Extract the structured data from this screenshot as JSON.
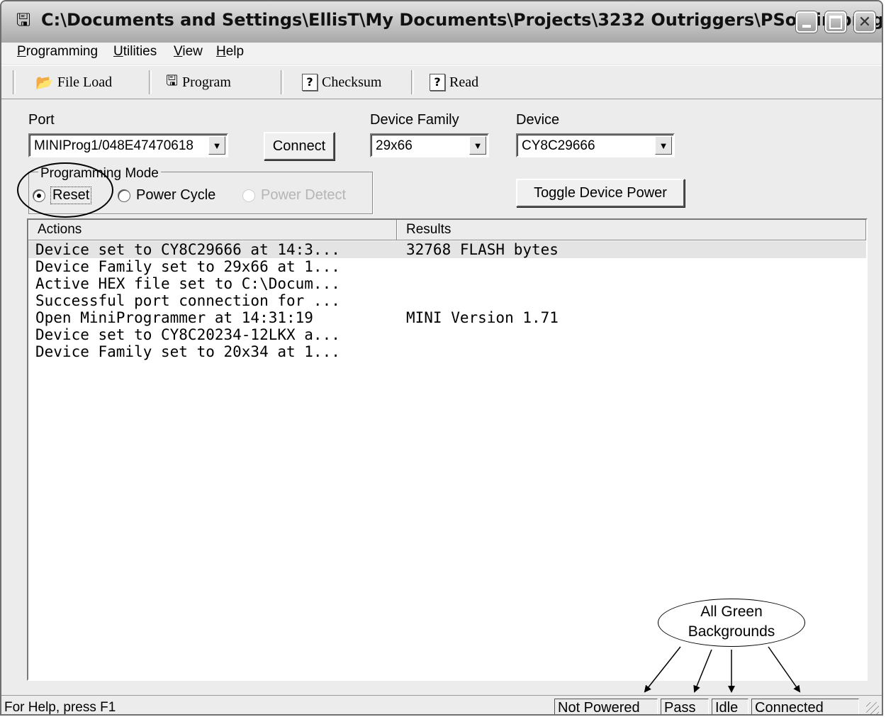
{
  "window": {
    "title": "C:\\Documents and Settings\\EllisT\\My Documents\\Projects\\3232 Outriggers\\PSoC\\in progress...",
    "icon": "programmer-app-icon",
    "controls": [
      "minimize",
      "maximize",
      "close"
    ]
  },
  "menu": [
    {
      "mnemonic": "P",
      "rest": "rogramming"
    },
    {
      "mnemonic": "U",
      "rest": "tilities"
    },
    {
      "mnemonic": "V",
      "rest": "iew"
    },
    {
      "mnemonic": "H",
      "rest": "elp"
    }
  ],
  "toolbar": {
    "file_load": "File Load",
    "program": "Program",
    "checksum": "Checksum",
    "read": "Read",
    "qmark": "?"
  },
  "port": {
    "label": "Port",
    "value": "MINIProg1/048E47470618"
  },
  "connect_button": "Connect",
  "device_family": {
    "label": "Device Family",
    "value": "29x66"
  },
  "device": {
    "label": "Device",
    "value": "CY8C29666"
  },
  "programming_mode": {
    "title": "Programming Mode",
    "options": [
      "Reset",
      "Power Cycle",
      "Power Detect"
    ],
    "selected": "Reset",
    "disabled": "Power Detect"
  },
  "toggle_power_button": "Toggle Device Power",
  "log": {
    "columns": [
      "Actions",
      "Results"
    ],
    "rows": [
      {
        "action": "Device set to CY8C29666 at 14:3...",
        "result": "32768 FLASH bytes"
      },
      {
        "action": "Device Family set to 29x66 at 1...",
        "result": ""
      },
      {
        "action": "Active HEX file set to C:\\Docum...",
        "result": ""
      },
      {
        "action": "Successful port connection for ...",
        "result": ""
      },
      {
        "action": "Open MiniProgrammer at 14:31:19",
        "result": "MINI Version 1.71"
      },
      {
        "action": "Device set to CY8C20234-12LKX a...",
        "result": ""
      },
      {
        "action": "Device Family set to 20x34 at 1...",
        "result": ""
      }
    ]
  },
  "status": {
    "help": "For Help, press F1",
    "power": "Not Powered",
    "result": "Pass",
    "state": "Idle",
    "connection": "Connected"
  },
  "annotation": {
    "line1": "All Green",
    "line2": "Backgrounds"
  }
}
